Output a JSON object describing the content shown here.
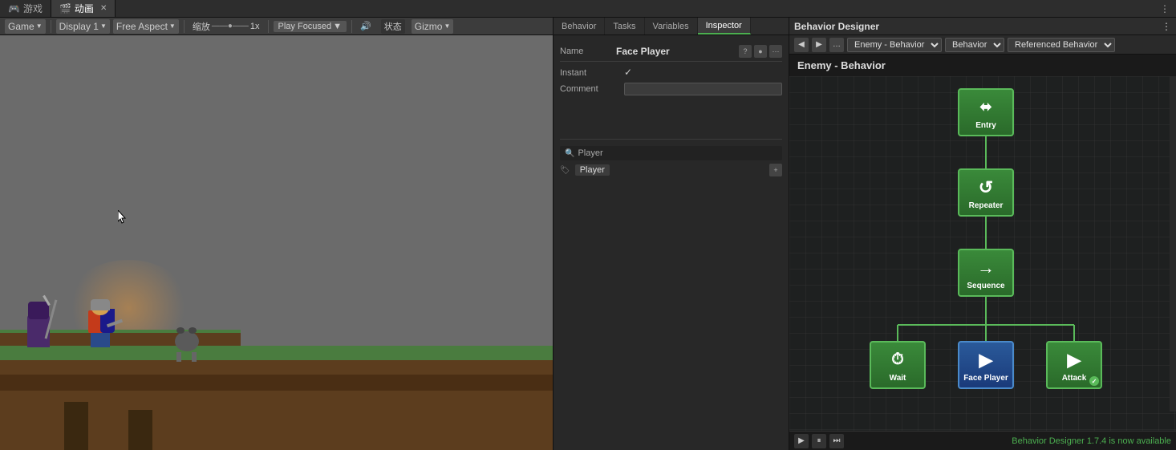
{
  "top_tabs": {
    "tab1": {
      "icon": "🎮",
      "label": "游戏",
      "active": false
    },
    "tab2": {
      "icon": "🎬",
      "label": "动画",
      "active": true
    }
  },
  "game_toolbar": {
    "game_label": "Game",
    "display_label": "Display 1",
    "aspect_label": "Free Aspect",
    "scale_label": "缩放",
    "zoom_label": "1x",
    "play_label": "Play Focused",
    "mute_icon": "🔊",
    "stats_label": "状态",
    "gizmo_label": "Gizmo"
  },
  "inspector": {
    "tabs": [
      "Behavior",
      "Tasks",
      "Variables",
      "Inspector"
    ],
    "active_tab": "Inspector",
    "nav": {
      "prev_label": "◀",
      "next_label": "▶",
      "dots_label": "...",
      "entity_label": "Enemy",
      "behavior_label": "Behavior",
      "ref_label": "Referenced Behavior"
    },
    "name_label": "Name",
    "name_value": "Face Player",
    "instant_label": "Instant",
    "instant_value": "✓",
    "comment_label": "Comment",
    "comment_value": "",
    "player_section": {
      "search_placeholder": "Player",
      "tag_label": "Player",
      "add_icon": "+"
    }
  },
  "behavior_designer": {
    "title": "Behavior Designer",
    "canvas_title": "Enemy - Behavior",
    "nodes": {
      "entry": {
        "label": "Entry",
        "icon": "⬌"
      },
      "repeater": {
        "label": "Repeater",
        "icon": "↺"
      },
      "sequence": {
        "label": "Sequence",
        "icon": "→"
      },
      "wait": {
        "label": "Wait",
        "icon": "⏱"
      },
      "face_player": {
        "label": "Face Player",
        "icon": "▶"
      },
      "attack": {
        "label": "Attack",
        "icon": "▶"
      }
    },
    "update_text": "Behavior Designer 1.7.4 is now available",
    "play_btn": "▶",
    "pause_btn": "⏸",
    "step_btn": "⏭"
  }
}
